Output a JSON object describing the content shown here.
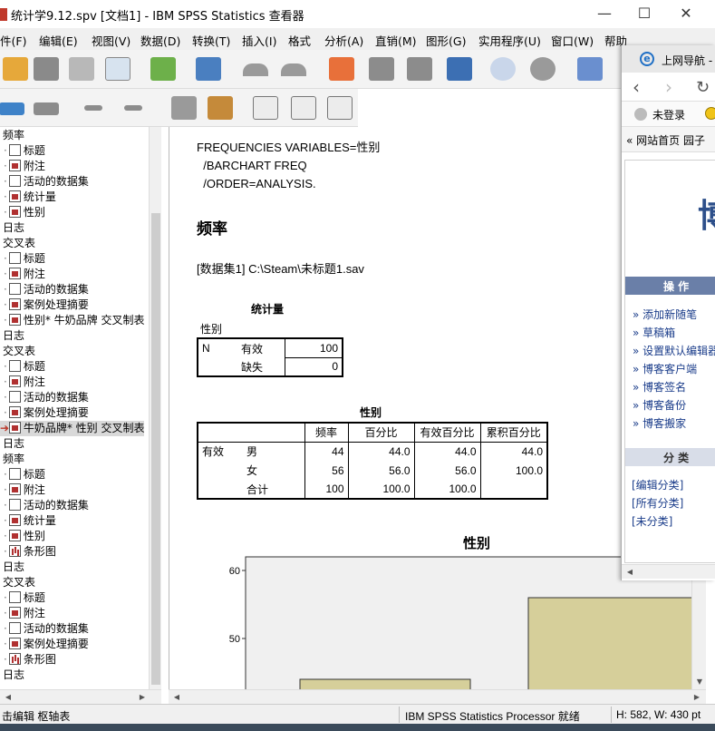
{
  "window": {
    "title": "统计学9.12.spv [文档1] - IBM SPSS Statistics 查看器",
    "minimize": "—",
    "maximize": "☐",
    "close": "✕"
  },
  "menu": [
    "件(F)",
    "编辑(E)",
    "视图(V)",
    "数据(D)",
    "转换(T)",
    "插入(I)",
    "格式",
    "分析(A)",
    "直销(M)",
    "图形(G)",
    "实用程序(U)",
    "窗口(W)",
    "帮助"
  ],
  "outline": [
    {
      "label": "频率",
      "level": 0
    },
    {
      "label": "标题",
      "level": 1,
      "icon": "doc"
    },
    {
      "label": "附注",
      "level": 1,
      "icon": "red"
    },
    {
      "label": "活动的数据集",
      "level": 1,
      "icon": "doc"
    },
    {
      "label": "统计量",
      "level": 1,
      "icon": "red"
    },
    {
      "label": "性别",
      "level": 1,
      "icon": "red"
    },
    {
      "label": "日志",
      "level": 0
    },
    {
      "label": "交叉表",
      "level": 0
    },
    {
      "label": "标题",
      "level": 1,
      "icon": "doc"
    },
    {
      "label": "附注",
      "level": 1,
      "icon": "red"
    },
    {
      "label": "活动的数据集",
      "level": 1,
      "icon": "doc"
    },
    {
      "label": "案例处理摘要",
      "level": 1,
      "icon": "red"
    },
    {
      "label": "性别* 牛奶品牌 交叉制表",
      "level": 1,
      "icon": "red"
    },
    {
      "label": "日志",
      "level": 0
    },
    {
      "label": "交叉表",
      "level": 0
    },
    {
      "label": "标题",
      "level": 1,
      "icon": "doc"
    },
    {
      "label": "附注",
      "level": 1,
      "icon": "red"
    },
    {
      "label": "活动的数据集",
      "level": 1,
      "icon": "doc"
    },
    {
      "label": "案例处理摘要",
      "level": 1,
      "icon": "red"
    },
    {
      "label": "牛奶品牌* 性别 交叉制表",
      "level": 1,
      "icon": "red",
      "selected": true
    },
    {
      "label": "日志",
      "level": 0
    },
    {
      "label": "频率",
      "level": 0
    },
    {
      "label": "标题",
      "level": 1,
      "icon": "doc"
    },
    {
      "label": "附注",
      "level": 1,
      "icon": "red"
    },
    {
      "label": "活动的数据集",
      "level": 1,
      "icon": "doc"
    },
    {
      "label": "统计量",
      "level": 1,
      "icon": "red"
    },
    {
      "label": "性别",
      "level": 1,
      "icon": "red"
    },
    {
      "label": "条形图",
      "level": 1,
      "icon": "bar"
    },
    {
      "label": "日志",
      "level": 0
    },
    {
      "label": "交叉表",
      "level": 0
    },
    {
      "label": "标题",
      "level": 1,
      "icon": "doc"
    },
    {
      "label": "附注",
      "level": 1,
      "icon": "red"
    },
    {
      "label": "活动的数据集",
      "level": 1,
      "icon": "doc"
    },
    {
      "label": "案例处理摘要",
      "level": 1,
      "icon": "red"
    },
    {
      "label": "条形图",
      "level": 1,
      "icon": "bar"
    },
    {
      "label": "日志",
      "level": 0
    }
  ],
  "content": {
    "syntax": [
      "FREQUENCIES VARIABLES=性别",
      "  /BARCHART FREQ",
      "  /ORDER=ANALYSIS."
    ],
    "heading": "频率",
    "dataset": "[数据集1] C:\\Steam\\未标题1.sav",
    "stats_table": {
      "title": "统计量",
      "variable": "性别",
      "rows": [
        [
          "N",
          "有效",
          "100"
        ],
        [
          "",
          "缺失",
          "0"
        ]
      ]
    },
    "freq_table": {
      "title": "性别",
      "headers": [
        "",
        "",
        "频率",
        "百分比",
        "有效百分比",
        "累积百分比"
      ],
      "rows": [
        [
          "有效",
          "男",
          "44",
          "44.0",
          "44.0",
          "44.0"
        ],
        [
          "",
          "女",
          "56",
          "56.0",
          "56.0",
          "100.0"
        ],
        [
          "",
          "合计",
          "100",
          "100.0",
          "100.0",
          ""
        ]
      ]
    }
  },
  "chart_data": {
    "type": "bar",
    "title": "性别",
    "categories": [
      "",
      ""
    ],
    "values": [
      44,
      56
    ],
    "yticks": [
      "60",
      "50"
    ],
    "ylim_visible": [
      42,
      62
    ],
    "bar_color": "#d6cf9a"
  },
  "statusbar": {
    "left": "击编辑 枢轴表",
    "processor": "IBM SPSS Statistics Processor 就绪",
    "size": "H: 582, W: 430 pt"
  },
  "browser": {
    "tab_title": "上网导航 -",
    "login": "未登录",
    "bookmarks": "« 网站首页  园子",
    "banner_glyph": "博",
    "section_ops": "操 作",
    "ops_links": [
      "» 添加新随笔",
      "» 草稿箱",
      "» 设置默认编辑器",
      "» 博客客户端",
      "» 博客签名",
      "» 博客备份",
      "» 博客搬家"
    ],
    "section_cat": "分 类",
    "cat_links": [
      "[编辑分类]",
      "[所有分类]",
      "[未分类]"
    ]
  }
}
